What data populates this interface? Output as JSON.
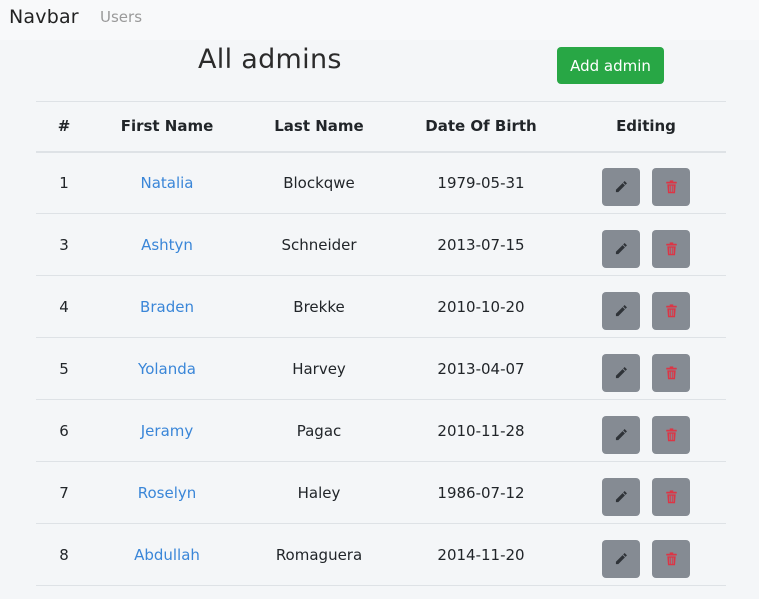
{
  "navbar": {
    "brand": "Navbar",
    "links": [
      "Users"
    ]
  },
  "page": {
    "title": "All admins",
    "add_button": "Add admin"
  },
  "table": {
    "headers": [
      "#",
      "First Name",
      "Last Name",
      "Date Of Birth",
      "Editing"
    ],
    "rows": [
      {
        "id": "1",
        "first_name": "Natalia",
        "last_name": "Blockqwe",
        "dob": "1979-05-31"
      },
      {
        "id": "3",
        "first_name": "Ashtyn",
        "last_name": "Schneider",
        "dob": "2013-07-15"
      },
      {
        "id": "4",
        "first_name": "Braden",
        "last_name": "Brekke",
        "dob": "2010-10-20"
      },
      {
        "id": "5",
        "first_name": "Yolanda",
        "last_name": "Harvey",
        "dob": "2013-04-07"
      },
      {
        "id": "6",
        "first_name": "Jeramy",
        "last_name": "Pagac",
        "dob": "2010-11-28"
      },
      {
        "id": "7",
        "first_name": "Roselyn",
        "last_name": "Haley",
        "dob": "1986-07-12"
      },
      {
        "id": "8",
        "first_name": "Abdullah",
        "last_name": "Romaguera",
        "dob": "2014-11-20"
      }
    ],
    "row_actions": [
      {
        "icon": "pencil-icon",
        "color": "#2f3338"
      },
      {
        "icon": "trash-icon",
        "color": "#dc3545"
      }
    ]
  },
  "colors": {
    "background": "#f4f6f8",
    "navbar": "#f8f9fa",
    "add_button": "#28a745",
    "action_button": "#858b93",
    "link": "#3a86d8",
    "trash": "#dc3545"
  }
}
